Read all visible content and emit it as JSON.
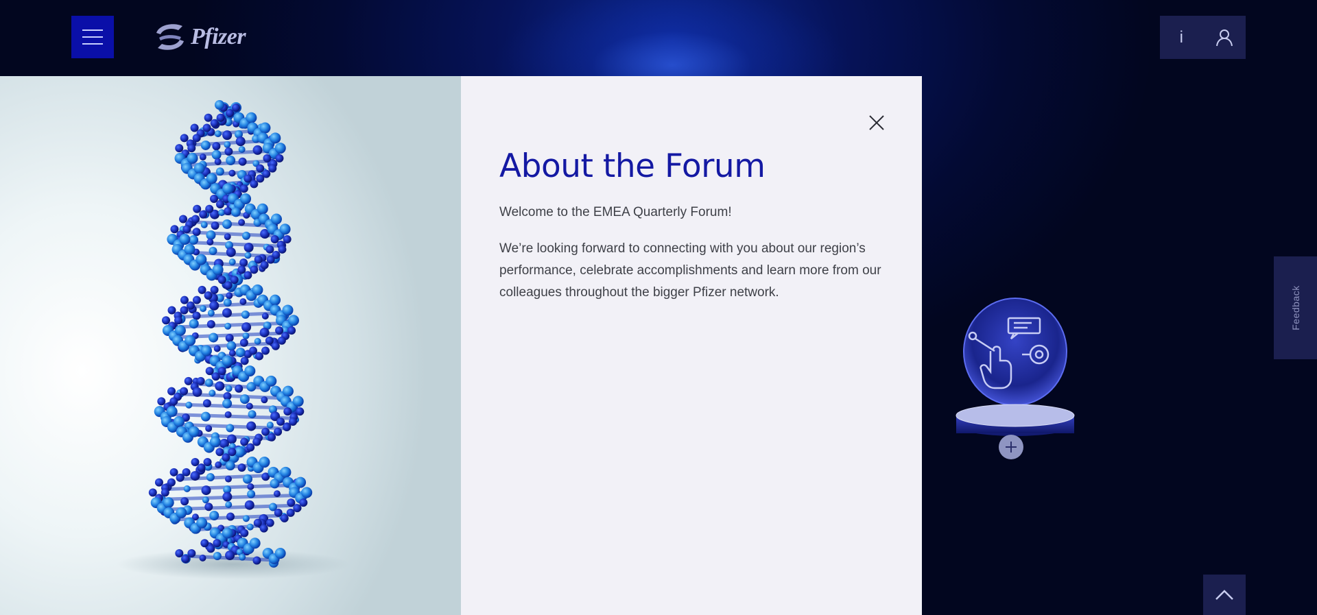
{
  "header": {
    "logo_text": "Pfizer",
    "menu_icon": "hamburger-icon",
    "info_label": "i",
    "user_icon": "user-icon"
  },
  "modal": {
    "title": "About the Forum",
    "welcome": "Welcome to the EMEA Quarterly Forum!",
    "body": "We’re looking forward to connecting with you about our region’s performance, celebrate accomplishments and learn more from our colleagues throughout the bigger Pfizer network.",
    "close_icon": "close-icon"
  },
  "hero": {
    "image": "dna-helix-image"
  },
  "hotspot": {
    "icon": "touch-interaction-icon",
    "expand_icon": "plus-icon"
  },
  "feedback": {
    "label": "Feedback"
  },
  "scroll_top": {
    "icon": "chevron-up-icon"
  },
  "colors": {
    "brand_blue": "#0a0fa8",
    "title_blue": "#1419a3",
    "panel_bg": "#f2f1f7",
    "dark_bg": "#030a33",
    "tab_bg": "#1b1f4f"
  }
}
